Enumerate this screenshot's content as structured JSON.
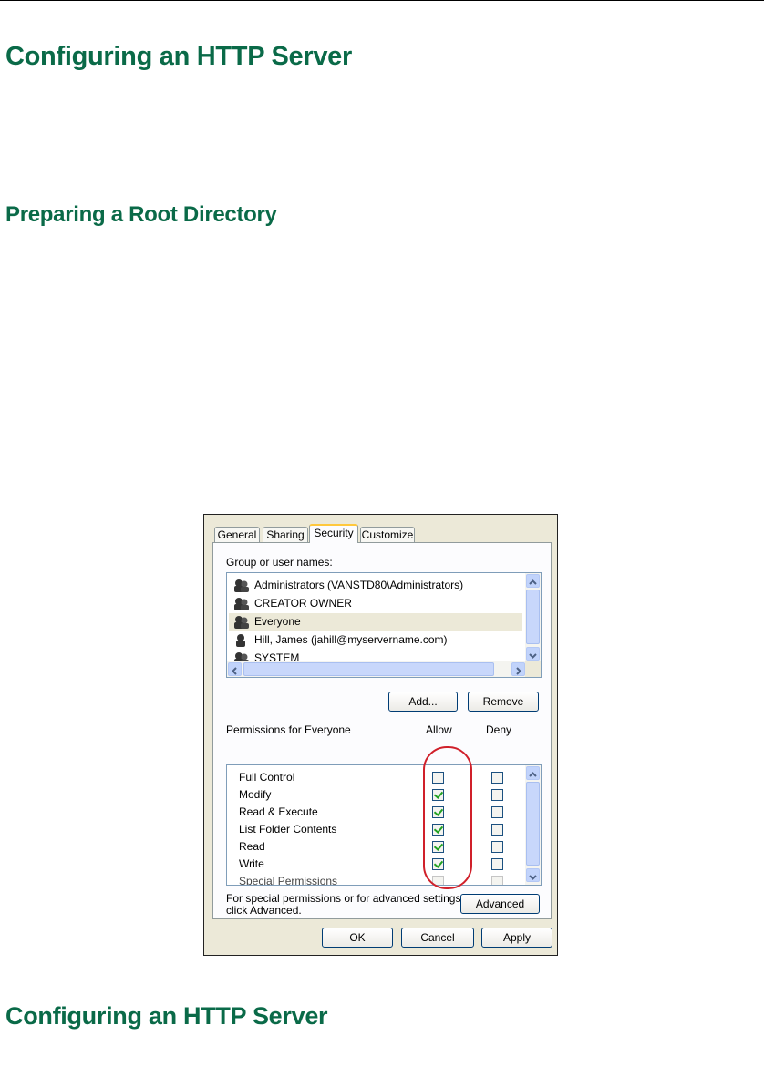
{
  "headings": {
    "h1": "Configuring an HTTP Server",
    "h2": "Preparing a Root Directory",
    "h3": "Configuring an HTTP Server"
  },
  "dialog": {
    "tabs": [
      "General",
      "Sharing",
      "Security",
      "Customize"
    ],
    "active_tab": "Security",
    "group_label": "Group or user names:",
    "users": [
      "Administrators (VANSTD80\\Administrators)",
      "CREATOR OWNER",
      "Everyone",
      "Hill, James (jahill@myservername.com)",
      "SYSTEM"
    ],
    "selected_user": "Everyone",
    "add_button": "Add...",
    "remove_button": "Remove",
    "permissions_label": "Permissions for Everyone",
    "allow_label": "Allow",
    "deny_label": "Deny",
    "permissions": [
      {
        "name": "Full Control",
        "allow": false,
        "deny": false
      },
      {
        "name": "Modify",
        "allow": true,
        "deny": false
      },
      {
        "name": "Read & Execute",
        "allow": true,
        "deny": false
      },
      {
        "name": "List Folder Contents",
        "allow": true,
        "deny": false
      },
      {
        "name": "Read",
        "allow": true,
        "deny": false
      },
      {
        "name": "Write",
        "allow": true,
        "deny": false
      },
      {
        "name": "Special Permissions",
        "allow": false,
        "deny": false
      }
    ],
    "special_note_line1": "For special permissions or for advanced settings,",
    "special_note_line2": "click Advanced.",
    "advanced_button": "Advanced",
    "ok_button": "OK",
    "cancel_button": "Cancel",
    "apply_button": "Apply",
    "highlight_color": "#d0202a"
  }
}
